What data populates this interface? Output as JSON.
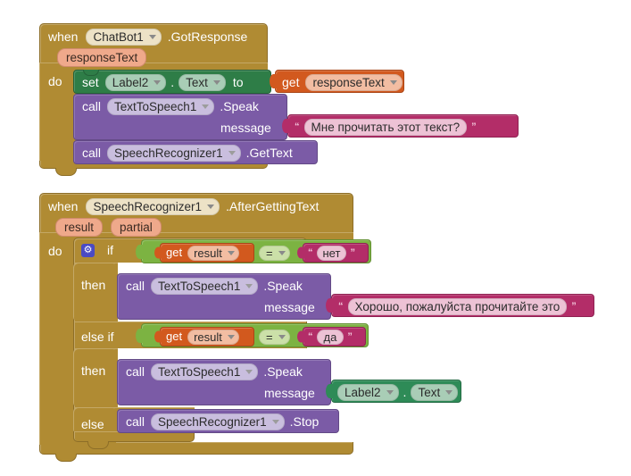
{
  "app": {
    "title": "MIT App Inventor Blocks Editor",
    "canvas_background": "#ffffff"
  },
  "palette": {
    "event_block": "#B08B33",
    "setter_block": "#2E7D47",
    "call_block": "#7B5BA6",
    "logic_block": "#7CB342",
    "getter_block": "#D2591E",
    "text_block": "#B32D68",
    "property_getter_block": "#2E8B57",
    "parameter_pill": "#EFA98B",
    "gear_icon": "#4A4AC4"
  },
  "blocks": [
    {
      "id": "event-chatbot-gotresponse",
      "keyword_when": "when",
      "component": "ChatBot1",
      "event": ".GotResponse",
      "parameters": [
        "responseText"
      ],
      "keyword_do": "do",
      "body": [
        {
          "id": "set-label2-text",
          "keyword_set": "set",
          "component": "Label2",
          "dot": ".",
          "property": "Text",
          "keyword_to": "to",
          "value": {
            "id": "get-responsetext",
            "keyword_get": "get",
            "variable": "responseText"
          }
        },
        {
          "id": "call-tts-speak-1",
          "keyword_call": "call",
          "component": "TextToSpeech1",
          "method": ".Speak",
          "arg_label": "message",
          "arg_value": {
            "id": "text-ask-read",
            "type": "text",
            "open_quote": "“",
            "close_quote": "”",
            "value": "Мне прочитать этот текст?"
          }
        },
        {
          "id": "call-speechrecognizer-gettext",
          "keyword_call": "call",
          "component": "SpeechRecognizer1",
          "method": ".GetText"
        }
      ]
    },
    {
      "id": "event-speechrecognizer-aftergettingtext",
      "keyword_when": "when",
      "component": "SpeechRecognizer1",
      "event": ".AfterGettingText",
      "parameters": [
        "result",
        "partial"
      ],
      "keyword_do": "do",
      "if_block": {
        "id": "control-if-elseif-else",
        "gear_icon": "gear-icon",
        "keyword_if": "if",
        "keyword_then": "then",
        "keyword_else_if": "else if",
        "keyword_else": "else",
        "branches": [
          {
            "condition": {
              "left": {
                "keyword_get": "get",
                "variable": "result"
              },
              "operator": "=",
              "right": {
                "type": "text",
                "open_quote": "“",
                "close_quote": "”",
                "value": "нет"
              }
            },
            "body": {
              "keyword_call": "call",
              "component": "TextToSpeech1",
              "method": ".Speak",
              "arg_label": "message",
              "arg_value": {
                "type": "text",
                "open_quote": "“",
                "close_quote": "”",
                "value": "Хорошо, пожалуйста прочитайте это"
              }
            }
          },
          {
            "condition": {
              "left": {
                "keyword_get": "get",
                "variable": "result"
              },
              "operator": "=",
              "right": {
                "type": "text",
                "open_quote": "“",
                "close_quote": "”",
                "value": "да"
              }
            },
            "body": {
              "keyword_call": "call",
              "component": "TextToSpeech1",
              "method": ".Speak",
              "arg_label": "message",
              "arg_value": {
                "type": "property_getter",
                "component": "Label2",
                "dot": ".",
                "property": "Text"
              }
            }
          }
        ],
        "else_body": {
          "keyword_call": "call",
          "component": "SpeechRecognizer1",
          "method": ".Stop"
        }
      }
    }
  ]
}
